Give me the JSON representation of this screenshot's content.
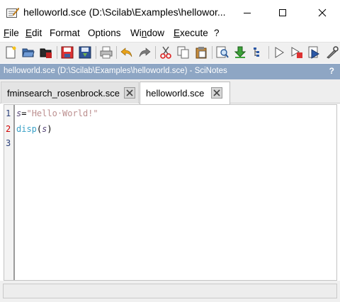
{
  "window": {
    "title": "helloworld.sce (D:\\Scilab\\Examples\\hellowor...",
    "minimize_glyph": "─",
    "maximize_glyph": "☐",
    "close_glyph": "✕"
  },
  "menu": [
    {
      "pre": "",
      "key": "F",
      "post": "ile"
    },
    {
      "pre": "",
      "key": "E",
      "post": "dit"
    },
    {
      "pre": "",
      "key": "",
      "post": "Format"
    },
    {
      "pre": "",
      "key": "",
      "post": "Options"
    },
    {
      "pre": "Wi",
      "key": "n",
      "post": "dow"
    },
    {
      "pre": "",
      "key": "E",
      "post": "xecute"
    },
    {
      "pre": "",
      "key": "",
      "post": "?"
    }
  ],
  "toolbar_icons": [
    "new-file-icon",
    "open-file-icon",
    "open-recent-icon",
    "save-icon",
    "save-as-icon",
    "print-icon",
    "undo-icon",
    "redo-icon",
    "cut-icon",
    "copy-icon",
    "paste-icon",
    "find-icon",
    "load-into-scilab-icon",
    "execute-to-cursor-icon",
    "run-icon",
    "run-echo-icon",
    "run-file-icon",
    "tools-icon"
  ],
  "docbar": {
    "title": "helloworld.sce (D:\\Scilab\\Examples\\helloworld.sce) - SciNotes",
    "help": "?"
  },
  "tabs": [
    {
      "label": "fminsearch_rosenbrock.sce",
      "active": false
    },
    {
      "label": "helloworld.sce",
      "active": true
    }
  ],
  "editor": {
    "lines": [
      {
        "num": "1",
        "var": "s",
        "op": "=",
        "str": "\"Hello·World!\""
      },
      {
        "num": "2",
        "fn": "disp",
        "open": "(",
        "var": "s",
        "close": ")"
      },
      {
        "num": "3"
      }
    ],
    "colors": {
      "string": "#bc8f8f",
      "function": "#3aa1c7",
      "active_line_number": "#d00000"
    }
  }
}
